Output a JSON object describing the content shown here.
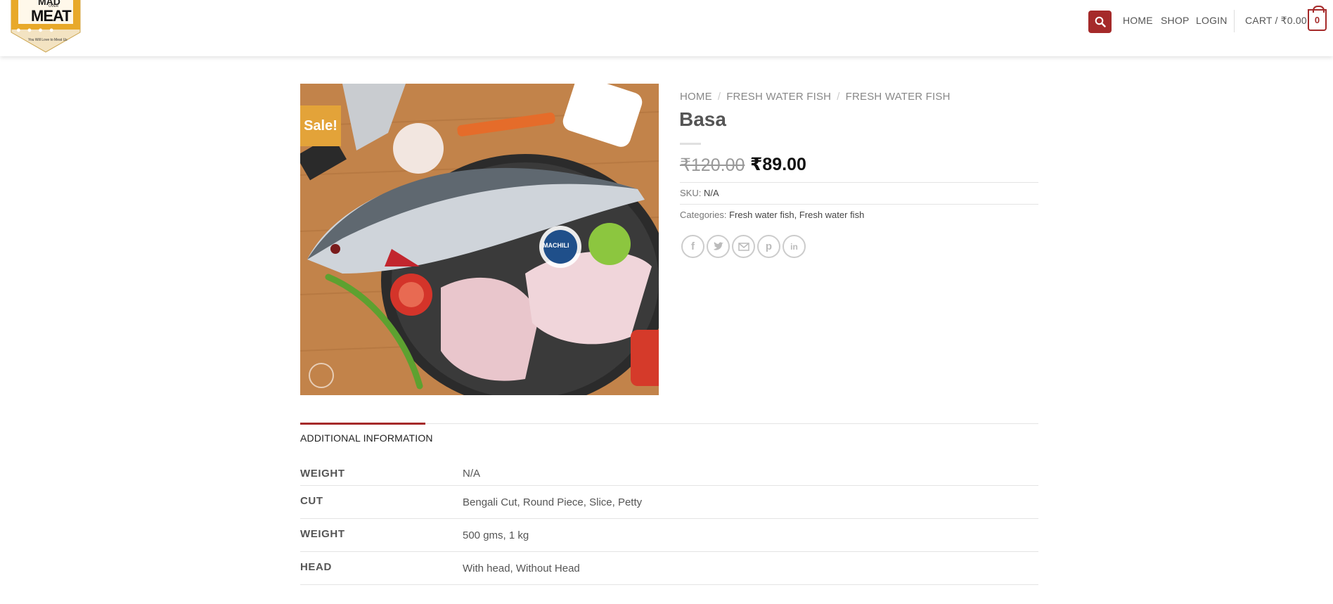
{
  "logo": {
    "top_text": "MAD",
    "small_text": "OVER",
    "main_text": "MEAT",
    "tagline": "You Will Love to Meat Us"
  },
  "nav": {
    "home": "HOME",
    "shop": "SHOP",
    "login": "LOGIN",
    "cart_label": "CART / ₹0.00",
    "cart_count": "0"
  },
  "product": {
    "sale_badge": "Sale!",
    "image_alt": "Basa fish with MACHILI logo",
    "brand_mark": "MACHILI",
    "breadcrumb": [
      "HOME",
      "FRESH WATER FISH",
      "FRESH WATER FISH"
    ],
    "title": "Basa",
    "price_old": "₹120.00",
    "price_new": "₹89.00",
    "sku_label": "SKU:",
    "sku_value": "N/A",
    "categories_label": "Categories:",
    "categories": [
      "Fresh water fish",
      "Fresh water fish"
    ]
  },
  "share_icons": [
    "facebook-icon",
    "twitter-icon",
    "email-icon",
    "pinterest-icon",
    "linkedin-icon"
  ],
  "tabs": {
    "active": "ADDITIONAL INFORMATION"
  },
  "attributes": [
    {
      "label": "WEIGHT",
      "value": "N/A"
    },
    {
      "label": "CUT",
      "value": "Bengali Cut, Round Piece, Slice, Petty"
    },
    {
      "label": "WEIGHT",
      "value": "500 gms, 1 kg"
    },
    {
      "label": "HEAD",
      "value": "With head, Without Head"
    }
  ],
  "colors": {
    "accent": "#a52a2a",
    "sale": "#e3a339",
    "logo_orange": "#e8a92a"
  }
}
